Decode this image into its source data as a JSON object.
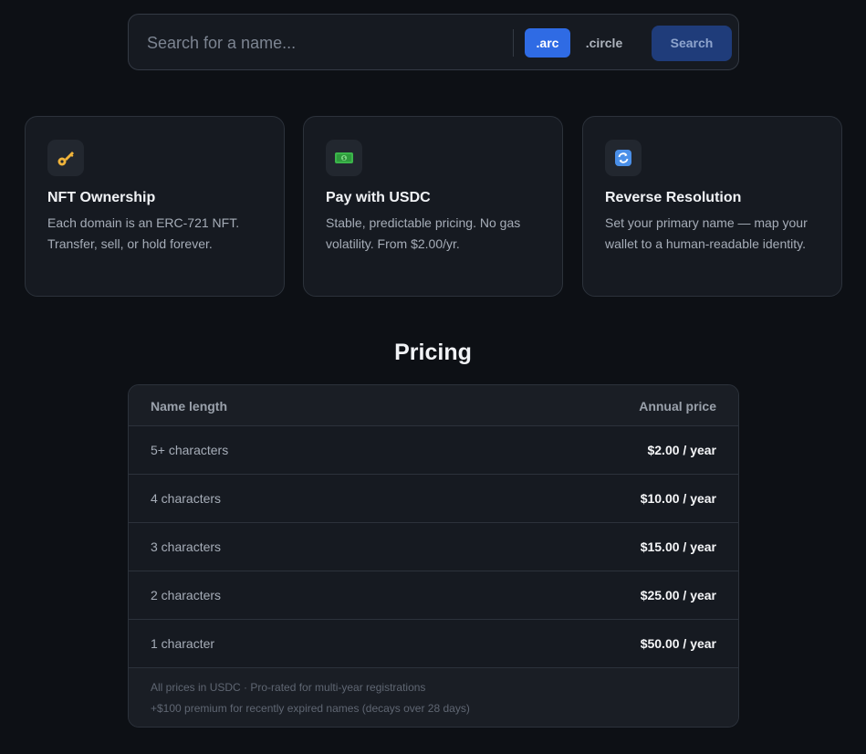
{
  "search": {
    "placeholder": "Search for a name...",
    "tlds": [
      ".arc",
      ".circle"
    ],
    "selected_tld": ".arc",
    "button_label": "Search"
  },
  "features": [
    {
      "icon": "key-icon",
      "title": "NFT Ownership",
      "description": "Each domain is an ERC-721 NFT. Transfer, sell, or hold forever."
    },
    {
      "icon": "money-icon",
      "title": "Pay with USDC",
      "description": "Stable, predictable pricing. No gas volatility. From $2.00/yr."
    },
    {
      "icon": "refresh-icon",
      "title": "Reverse Resolution",
      "description": "Set your primary name — map your wallet to a human-readable identity."
    }
  ],
  "pricing": {
    "title": "Pricing",
    "header_length": "Name length",
    "header_price": "Annual price",
    "rows": [
      {
        "length": "5+ characters",
        "price": "$2.00 / year"
      },
      {
        "length": "4 characters",
        "price": "$10.00 / year"
      },
      {
        "length": "3 characters",
        "price": "$15.00 / year"
      },
      {
        "length": "2 characters",
        "price": "$25.00 / year"
      },
      {
        "length": "1 character",
        "price": "$50.00 / year"
      }
    ],
    "notes": [
      "All prices in USDC · Pro-rated for multi-year registrations",
      "+$100 premium for recently expired names (decays over 28 days)"
    ]
  },
  "colors": {
    "background": "#0d1015",
    "accent": "#2f6be4",
    "search_button": "#1f3c7a"
  }
}
